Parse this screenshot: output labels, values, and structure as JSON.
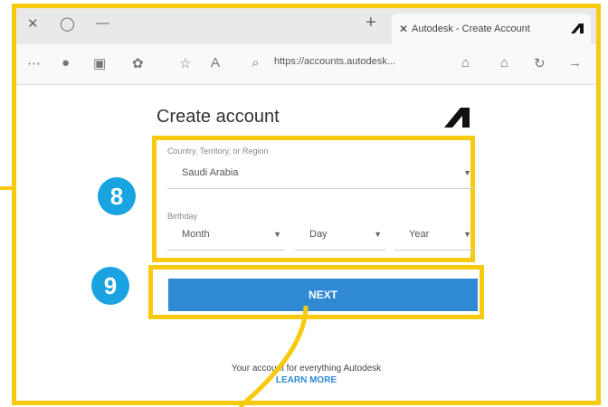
{
  "browser": {
    "tab_title": "Autodesk - Create Account",
    "tab_close": "✕",
    "new_tab": "+",
    "minimize": "—",
    "window_close": "✕",
    "restore": "◯",
    "url": "https://accounts.autodesk...",
    "icons": [
      "back-icon",
      "profile-icon",
      "collections-icon",
      "extensions-icon",
      "favorites-icon",
      "read-aloud-icon",
      "lock-icon",
      "home-icon",
      "refresh-icon",
      "forward-icon"
    ]
  },
  "form": {
    "title": "Create account",
    "country_label": "Country, Territory, or Region",
    "country_value": "Saudi Arabia",
    "birthday_label": "Birthday",
    "month": "Month",
    "day": "Day",
    "year": "Year",
    "next_label": "NEXT",
    "arrow": "▼"
  },
  "footer": {
    "text": "Your account for everything Autodesk",
    "learn_more": "LEARN MORE"
  },
  "annotations": {
    "step8": "8",
    "step9": "9"
  },
  "colors": {
    "highlight": "#f7c90f",
    "badge": "#19a3e0",
    "button": "#2f8ad3"
  }
}
